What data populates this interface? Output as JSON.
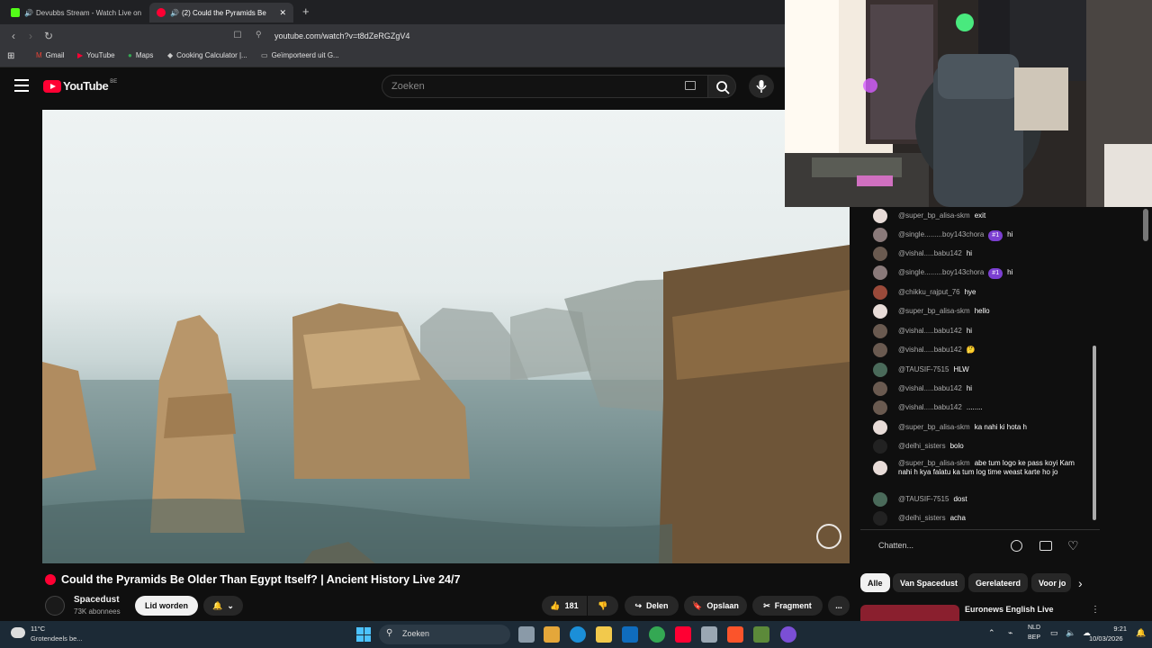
{
  "browser": {
    "tabs": [
      {
        "label": "Devubbs Stream - Watch Live on",
        "active": false
      },
      {
        "label": "(2) Could the Pyramids Be",
        "active": true
      }
    ],
    "new_tab": "+",
    "tab_close": "✕",
    "url": "youtube.com/watch?v=t8dZeRGZgV4",
    "bookmarks": [
      "Gmail",
      "YouTube",
      "Maps",
      "Cooking Calculator |...",
      "Geïmporteerd uit G..."
    ]
  },
  "youtube": {
    "logo_text": "YouTube",
    "region": "BE",
    "search_placeholder": "Zoeken"
  },
  "video": {
    "title": "Could the Pyramids Be Older Than Egypt Itself? | Ancient History Live 24/7"
  },
  "channel": {
    "name": "Spacedust",
    "subscribers": "73K abonnees",
    "join_label": "Lid worden"
  },
  "actions": {
    "likes": "181",
    "share": "Delen",
    "save": "Opslaan",
    "clip": "Fragment",
    "more": "..."
  },
  "chat": {
    "messages": [
      {
        "author": "@super_bp_alisa-skm",
        "text": "exit",
        "badge": ""
      },
      {
        "author": "@single.........boy143chora",
        "text": "hi",
        "badge": "#1"
      },
      {
        "author": "@vishal.....babu142",
        "text": "hi",
        "badge": ""
      },
      {
        "author": "@single.........boy143chora",
        "text": "hi",
        "badge": "#1"
      },
      {
        "author": "@chikku_rajput_76",
        "text": "hye",
        "badge": ""
      },
      {
        "author": "@super_bp_alisa-skm",
        "text": "hello",
        "badge": ""
      },
      {
        "author": "@vishal.....babu142",
        "text": "hi",
        "badge": ""
      },
      {
        "author": "@vishal.....babu142",
        "text": "🤔",
        "badge": ""
      },
      {
        "author": "@TAUSIF-7515",
        "text": "HLW",
        "badge": ""
      },
      {
        "author": "@vishal.....babu142",
        "text": "hi",
        "badge": ""
      },
      {
        "author": "@vishal.....babu142",
        "text": "........",
        "badge": ""
      },
      {
        "author": "@super_bp_alisa-skm",
        "text": "ka nahi ki hota h",
        "badge": ""
      },
      {
        "author": "@delhi_sisters",
        "text": "bolo",
        "badge": ""
      },
      {
        "author": "@super_bp_alisa-skm",
        "text": "abe tum logo ke pass koyi Kam nahi h kya falatu ka tum log time weast karte ho jo",
        "badge": ""
      },
      {
        "author": "@TAUSIF-7515",
        "text": "dost",
        "badge": ""
      },
      {
        "author": "@delhi_sisters",
        "text": "acha",
        "badge": ""
      }
    ],
    "input_placeholder": "Chatten..."
  },
  "chips": [
    "Alle",
    "Van Spacedust",
    "Gerelateerd",
    "Voor jo"
  ],
  "recommended": {
    "title": "Euronews English Live"
  },
  "taskbar": {
    "weather_temp": "11°C",
    "weather_desc": "Grotendeels be...",
    "search_label": "Zoeken",
    "lang_top": "NLD",
    "lang_bottom": "BEP",
    "time": "9:21",
    "date": "10/03/2026"
  },
  "colors": {
    "live_red": "#ff0033",
    "chat_badge": "#7b3fd1",
    "taskbar": "#1c2a36"
  }
}
